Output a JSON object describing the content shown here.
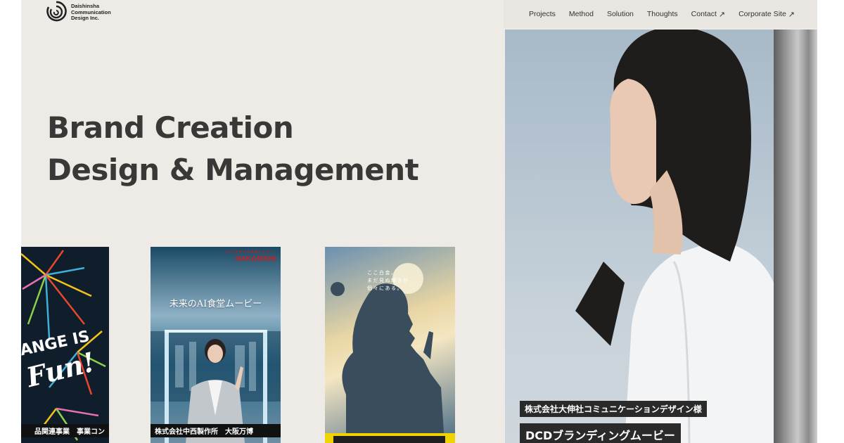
{
  "logo": {
    "line1": "Daishinsha",
    "line2": "Communication",
    "line3": "Design Inc."
  },
  "nav": {
    "items": [
      {
        "label": "Projects"
      },
      {
        "label": "Method"
      },
      {
        "label": "Solution"
      },
      {
        "label": "Thoughts"
      },
      {
        "label": "Contact",
        "icon": "arrow-up-right-icon"
      },
      {
        "label": "Corporate Site",
        "icon": "arrow-up-right-icon"
      }
    ],
    "arrow_glyph": "↗"
  },
  "hero": {
    "line1": "Brand Creation",
    "line2": "Design & Management"
  },
  "cards": [
    {
      "caption": "品関連事業　事業コン",
      "art_text_1": "ANGE IS",
      "art_text_2": "Fun!"
    },
    {
      "caption": "株式会社中西製作所　大阪万博",
      "brand": "NAKANISHI",
      "brand_tagline": "いただきます!の未来をつくる。",
      "title": "未来のAI食堂ムービー"
    },
    {
      "copy": [
        "ここ白金。",
        "まだ見ぬ輝きが",
        "個々にある。"
      ]
    }
  ],
  "feature": {
    "subtitle": "株式会社大伸社コミュニケーションデザイン様",
    "title": "DCDブランディングムービー"
  },
  "colors": {
    "page_bg": "#eeebe6",
    "heading": "#3a3836",
    "brand_red": "#d41b1b",
    "caption_bg": "#2a2a2a"
  }
}
